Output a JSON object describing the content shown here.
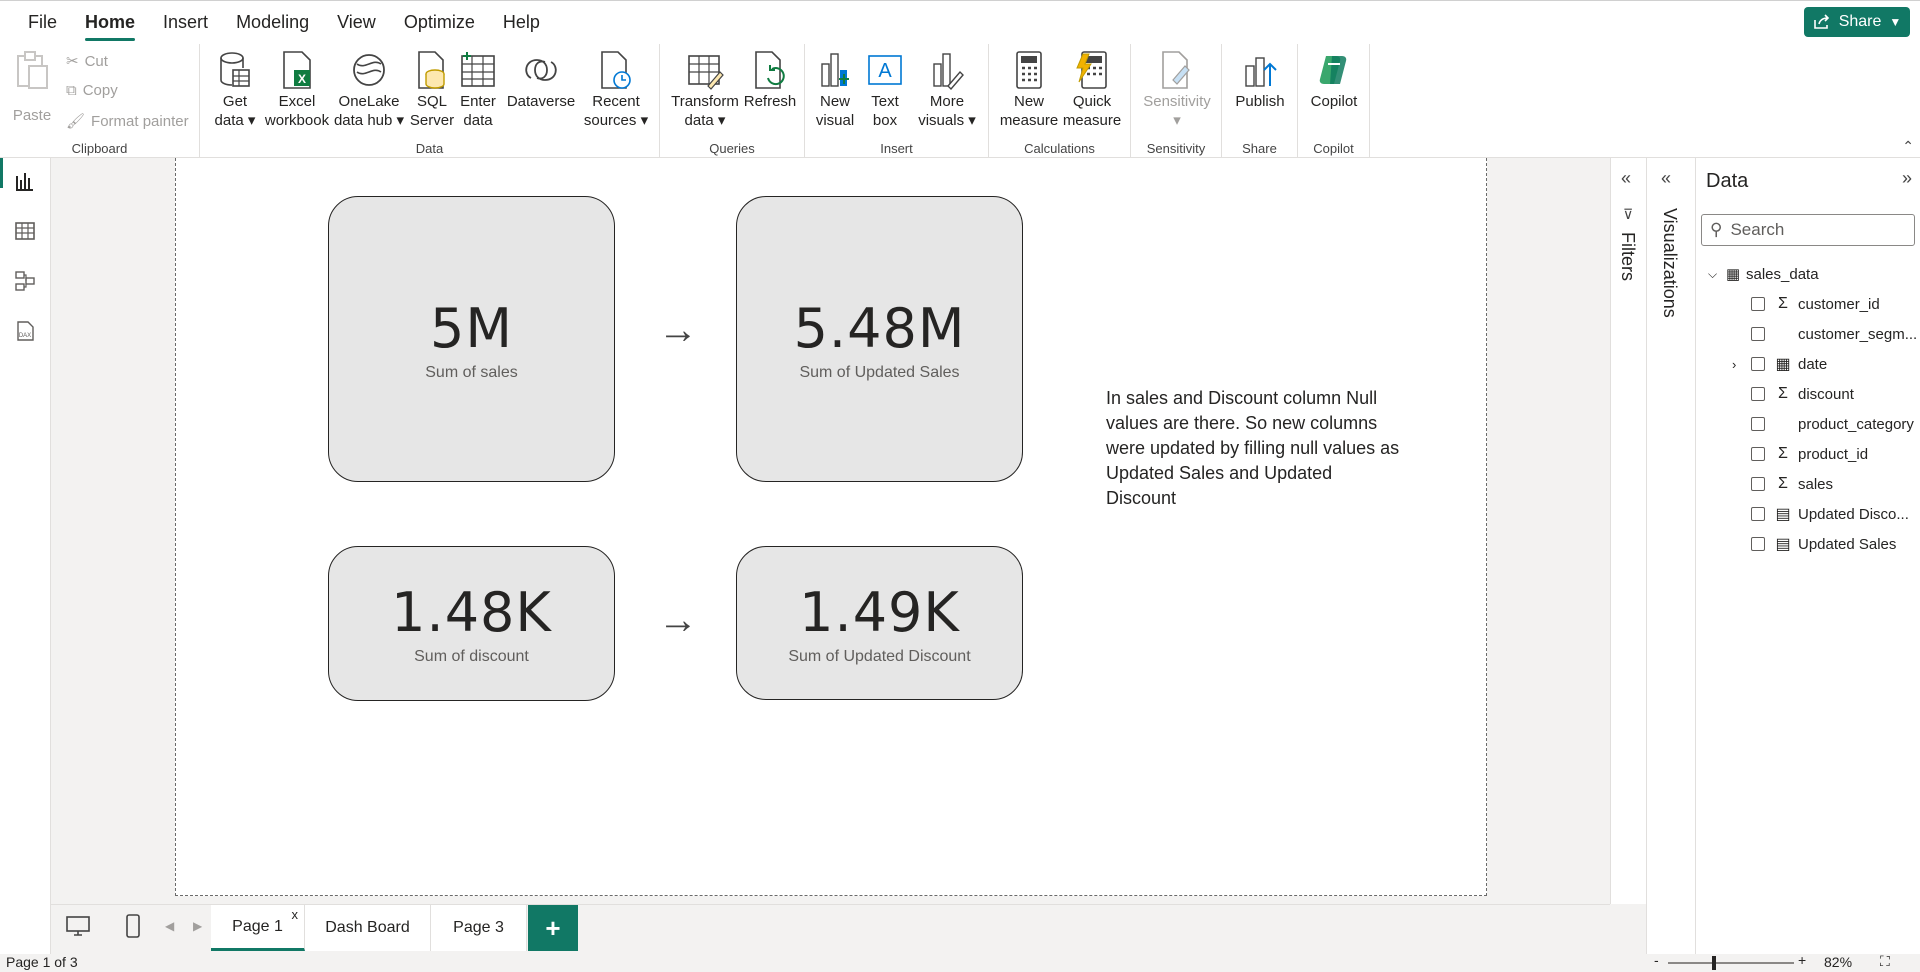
{
  "menu": {
    "items": [
      "File",
      "Home",
      "Insert",
      "Modeling",
      "View",
      "Optimize",
      "Help"
    ],
    "active": "Home",
    "share_label": "Share"
  },
  "ribbon": {
    "clipboard": {
      "paste": "Paste",
      "cut": "Cut",
      "copy": "Copy",
      "format_painter": "Format painter",
      "label": "Clipboard"
    },
    "data": {
      "get_data": [
        "Get",
        "data"
      ],
      "excel": [
        "Excel",
        "workbook"
      ],
      "onelake": [
        "OneLake",
        "data hub"
      ],
      "sql": [
        "SQL",
        "Server"
      ],
      "enter": [
        "Enter",
        "data"
      ],
      "dataverse": [
        "Dataverse",
        ""
      ],
      "recent": [
        "Recent",
        "sources"
      ],
      "label": "Data"
    },
    "queries": {
      "transform": [
        "Transform",
        "data"
      ],
      "refresh": [
        "Refresh",
        ""
      ],
      "label": "Queries"
    },
    "insert": {
      "new_visual": [
        "New",
        "visual"
      ],
      "text_box": [
        "Text",
        "box"
      ],
      "more_visuals": [
        "More",
        "visuals"
      ],
      "label": "Insert"
    },
    "calculations": {
      "new_measure": [
        "New",
        "measure"
      ],
      "quick_measure": [
        "Quick",
        "measure"
      ],
      "label": "Calculations"
    },
    "sensitivity": {
      "button": "Sensitivity",
      "label": "Sensitivity"
    },
    "share": {
      "publish": "Publish",
      "label": "Share"
    },
    "copilot": {
      "button": "Copilot",
      "label": "Copilot"
    }
  },
  "cards": [
    {
      "value": "5M",
      "label": "Sum of sales"
    },
    {
      "value": "5.48M",
      "label": "Sum of Updated Sales"
    },
    {
      "value": "1.48K",
      "label": "Sum of discount"
    },
    {
      "value": "1.49K",
      "label": "Sum of Updated Discount"
    }
  ],
  "arrow": "→",
  "note": "In sales and Discount column Null values are there. So new columns were updated by filling null values as Updated Sales and Updated Discount",
  "tabs": [
    {
      "label": "Page 1",
      "close": "x"
    },
    {
      "label": "Dash Board"
    },
    {
      "label": "Page 3"
    }
  ],
  "add_tab": "+",
  "status": {
    "page_info": "Page 1 of 3",
    "zoom": "82%",
    "zoom_minus": "-",
    "zoom_plus": "+"
  },
  "panes": {
    "filters": "Filters",
    "visualizations": "Visualizations",
    "data_title": "Data",
    "search_placeholder": "Search"
  },
  "table": {
    "name": "sales_data",
    "fields": [
      {
        "name": "customer_id",
        "type": "Σ"
      },
      {
        "name": "customer_segm...",
        "type": ""
      },
      {
        "name": "date",
        "type": "▦"
      },
      {
        "name": "discount",
        "type": "Σ"
      },
      {
        "name": "product_category",
        "type": ""
      },
      {
        "name": "product_id",
        "type": "Σ"
      },
      {
        "name": "sales",
        "type": "Σ"
      },
      {
        "name": "Updated Disco...",
        "type": "▤"
      },
      {
        "name": "Updated Sales",
        "type": "▤"
      }
    ]
  },
  "colors": {
    "accent": "#117865",
    "card_bg": "#e6e6e6"
  }
}
